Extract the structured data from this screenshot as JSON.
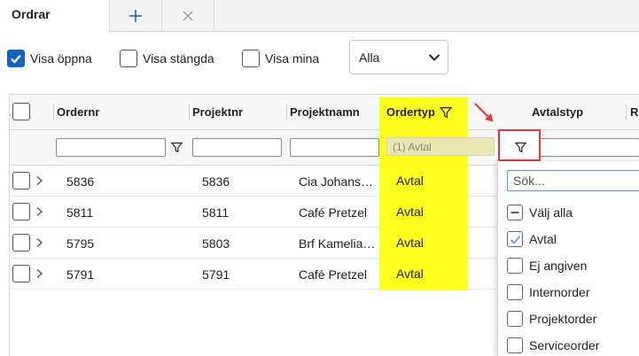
{
  "tabs": {
    "active_label": "Ordrar",
    "add_icon": "plus-icon",
    "close_icon": "close-icon"
  },
  "toolbar": {
    "show_open": {
      "label": "Visa öppna",
      "checked": true
    },
    "show_closed": {
      "label": "Visa stängda",
      "checked": false
    },
    "show_mine": {
      "label": "Visa mina",
      "checked": false
    },
    "scope_select": {
      "value": "Alla"
    }
  },
  "grid": {
    "columns": {
      "ordernr": "Ordernr",
      "projektnr": "Projektnr",
      "projektnamn": "Projektnamn",
      "ordertyp": "Ordertyp",
      "avtalstyp": "Avtalstyp",
      "next": "Ra"
    },
    "filter": {
      "ordertyp_value": "(1) Avtal"
    },
    "rows": [
      {
        "ordernr": "5836",
        "projektnr": "5836",
        "projektnamn": "Cia Johans…",
        "ordertyp": "Avtal"
      },
      {
        "ordernr": "5811",
        "projektnr": "5811",
        "projektnamn": "Café Pretzel",
        "ordertyp": "Avtal"
      },
      {
        "ordernr": "5795",
        "projektnr": "5803",
        "projektnamn": "Brf Kamelia…",
        "ordertyp": "Avtal"
      },
      {
        "ordernr": "5791",
        "projektnr": "5791",
        "projektnamn": "Café Pretzel",
        "ordertyp": "Avtal"
      }
    ]
  },
  "filter_panel": {
    "search_placeholder": "Sök...",
    "options": [
      {
        "label": "Välj alla",
        "state": "indeterminate"
      },
      {
        "label": "Avtal",
        "state": "checked"
      },
      {
        "label": "Ej angiven",
        "state": "unchecked"
      },
      {
        "label": "Internorder",
        "state": "unchecked"
      },
      {
        "label": "Projektorder",
        "state": "unchecked"
      },
      {
        "label": "Serviceorder",
        "state": "unchecked"
      }
    ]
  },
  "colors": {
    "accent": "#1565c0",
    "highlight": "#ffff00",
    "annotation": "#e53935"
  }
}
